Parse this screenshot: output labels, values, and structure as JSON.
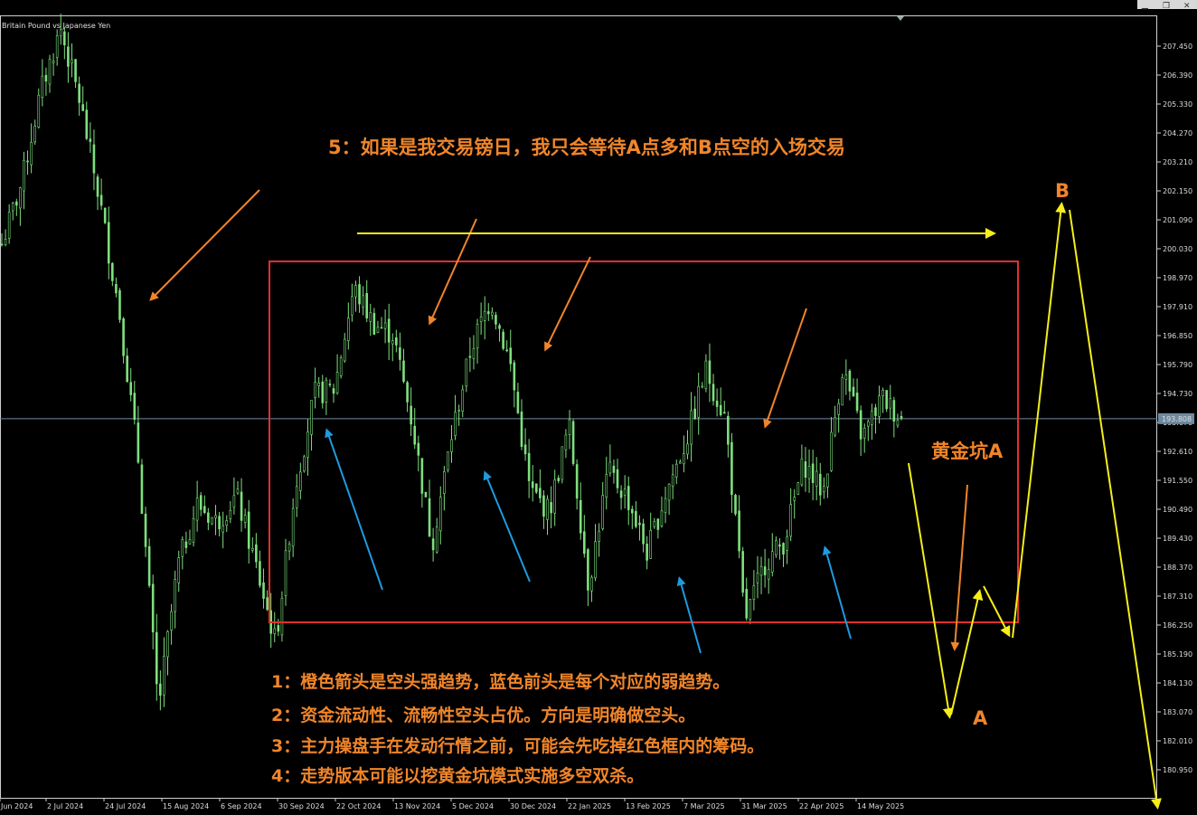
{
  "chart_data": {
    "type": "candlestick",
    "symbol": "Britain Pound vs Japanese Yen",
    "current_price": "193.808",
    "ylim": [
      179.8,
      208.5
    ],
    "y_ticks": [
      "207.450",
      "206.390",
      "205.330",
      "204.270",
      "203.210",
      "202.150",
      "201.090",
      "200.030",
      "198.970",
      "197.910",
      "196.850",
      "195.790",
      "194.730",
      "193.670",
      "192.610",
      "191.550",
      "190.490",
      "189.430",
      "188.370",
      "187.310",
      "186.250",
      "185.190",
      "184.130",
      "183.070",
      "182.010",
      "180.950"
    ],
    "x_ticks": [
      "Jun 2024",
      "2 Jul 2024",
      "24 Jul 2024",
      "15 Aug 2024",
      "6 Sep 2024",
      "30 Sep 2024",
      "22 Oct 2024",
      "13 Nov 2024",
      "5 Dec 2024",
      "30 Dec 2024",
      "22 Jan 2025",
      "13 Feb 2025",
      "7 Mar 2025",
      "31 Mar 2025",
      "22 Apr 2025",
      "14 May 2025"
    ],
    "colors": {
      "candle": "#7ee07e",
      "orange": "#f0852a",
      "blue": "#1e9be0",
      "yellow": "#f5ee1a",
      "box": "#e03030",
      "grid_line": "#6f8aa0"
    },
    "price_path_keypoints": [
      {
        "date": "Jun 2024",
        "price": 200.2
      },
      {
        "date": "Jun 2024",
        "price": 202.4
      },
      {
        "date": "2 Jul 2024",
        "price": 205.8
      },
      {
        "date": "2 Jul 2024",
        "price": 208.1
      },
      {
        "date": "2 Jul 2024",
        "price": 205.4
      },
      {
        "date": "24 Jul 2024",
        "price": 201.8
      },
      {
        "date": "24 Jul 2024",
        "price": 197.8
      },
      {
        "date": "24 Jul 2024",
        "price": 192.2
      },
      {
        "date": "24 Jul 2024",
        "price": 183.2
      },
      {
        "date": "15 Aug 2024",
        "price": 188.4
      },
      {
        "date": "15 Aug 2024",
        "price": 190.7
      },
      {
        "date": "15 Aug 2024",
        "price": 190.0
      },
      {
        "date": "6 Sep 2024",
        "price": 191.0
      },
      {
        "date": "6 Sep 2024",
        "price": 188.4
      },
      {
        "date": "6 Sep 2024",
        "price": 185.6
      },
      {
        "date": "30 Sep 2024",
        "price": 191.3
      },
      {
        "date": "30 Sep 2024",
        "price": 194.7
      },
      {
        "date": "30 Sep 2024",
        "price": 194.9
      },
      {
        "date": "22 Oct 2024",
        "price": 198.6
      },
      {
        "date": "22 Oct 2024",
        "price": 197.3
      },
      {
        "date": "22 Oct 2024",
        "price": 196.9
      },
      {
        "date": "13 Nov 2024",
        "price": 193.6
      },
      {
        "date": "13 Nov 2024",
        "price": 189.2
      },
      {
        "date": "13 Nov 2024",
        "price": 193.2
      },
      {
        "date": "5 Dec 2024",
        "price": 196.4
      },
      {
        "date": "5 Dec 2024",
        "price": 198.2
      },
      {
        "date": "30 Dec 2024",
        "price": 195.8
      },
      {
        "date": "30 Dec 2024",
        "price": 191.2
      },
      {
        "date": "30 Dec 2024",
        "price": 190.4
      },
      {
        "date": "22 Jan 2025",
        "price": 193.6
      },
      {
        "date": "22 Jan 2025",
        "price": 187.7
      },
      {
        "date": "22 Jan 2025",
        "price": 191.9
      },
      {
        "date": "13 Feb 2025",
        "price": 190.9
      },
      {
        "date": "13 Feb 2025",
        "price": 188.9
      },
      {
        "date": "7 Mar 2025",
        "price": 191.2
      },
      {
        "date": "7 Mar 2025",
        "price": 193.0
      },
      {
        "date": "7 Mar 2025",
        "price": 195.6
      },
      {
        "date": "31 Mar 2025",
        "price": 193.8
      },
      {
        "date": "31 Mar 2025",
        "price": 186.4
      },
      {
        "date": "31 Mar 2025",
        "price": 188.5
      },
      {
        "date": "22 Apr 2025",
        "price": 189.3
      },
      {
        "date": "22 Apr 2025",
        "price": 192.2
      },
      {
        "date": "22 Apr 2025",
        "price": 191.1
      },
      {
        "date": "14 May 2025",
        "price": 195.7
      },
      {
        "date": "14 May 2025",
        "price": 193.1
      },
      {
        "date": "14 May 2025",
        "price": 194.6
      },
      {
        "date": "14 May 2025",
        "price": 193.8
      }
    ],
    "annotations": {
      "title_note": "5：如果是我交易镑日，我只会等待A点多和B点空的入场交易",
      "pit_label": "黄金坑A",
      "label_a": "A",
      "label_b": "B",
      "notes": [
        "1：橙色箭头是空头强趋势，蓝色前头是每个对应的弱趋势。",
        "2：资金流动性、流畅性空头占优。方向是明确做空头。",
        "3：主力操盘手在发动行情之前，可能会先吃掉红色框内的筹码。",
        "4：走势版本可能以挖黄金坑模式实施多空双杀。"
      ]
    }
  }
}
